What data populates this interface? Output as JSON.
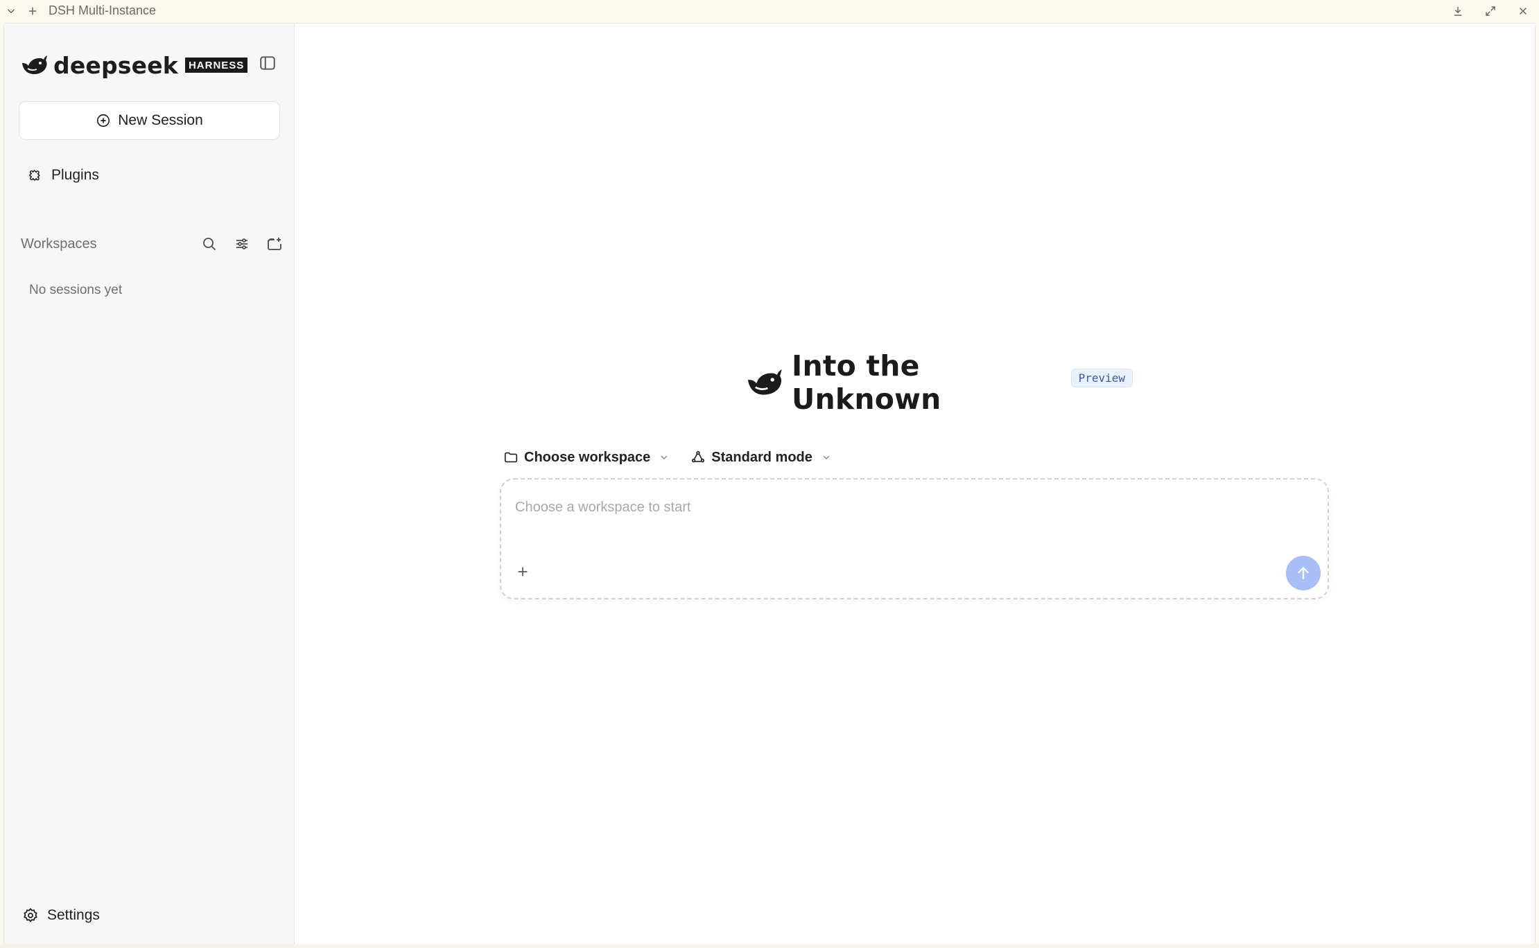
{
  "titlebar": {
    "title": "DSH Multi-Instance",
    "icons": [
      "chevron-down-icon",
      "plus-icon",
      "download-icon",
      "maximize-icon",
      "close-icon"
    ]
  },
  "sidebar": {
    "brand": {
      "name": "deepseek",
      "tag": "HARNESS"
    },
    "new_session_label": "New Session",
    "plugins_label": "Plugins",
    "workspaces_label": "Workspaces",
    "empty_label": "No sessions yet",
    "settings_label": "Settings"
  },
  "main": {
    "title": "Into the Unknown",
    "badge": "Preview",
    "workspace_select": "Choose workspace",
    "mode_select": "Standard mode",
    "composer_placeholder": "Choose a workspace to start"
  },
  "colors": {
    "accent_send": "#a9bdf6",
    "badge_bg": "#eaf1fe",
    "badge_text": "#3d57a8",
    "sidebar_bg": "#f7f7f7"
  }
}
